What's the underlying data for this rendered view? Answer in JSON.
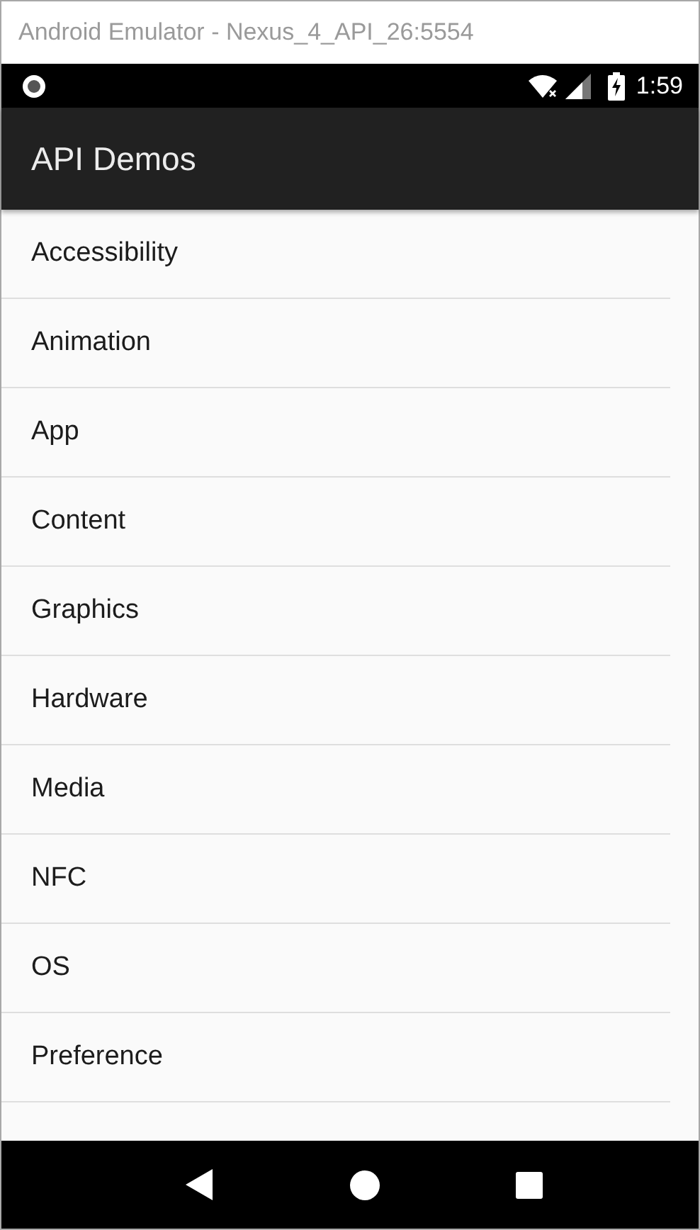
{
  "window": {
    "title": "Android Emulator - Nexus_4_API_26:5554"
  },
  "status_bar": {
    "time": "1:59"
  },
  "app_bar": {
    "title": "API Demos"
  },
  "list": {
    "items": [
      {
        "label": "Accessibility"
      },
      {
        "label": "Animation"
      },
      {
        "label": "App"
      },
      {
        "label": "Content"
      },
      {
        "label": "Graphics"
      },
      {
        "label": "Hardware"
      },
      {
        "label": "Media"
      },
      {
        "label": "NFC"
      },
      {
        "label": "OS"
      },
      {
        "label": "Preference"
      }
    ]
  }
}
